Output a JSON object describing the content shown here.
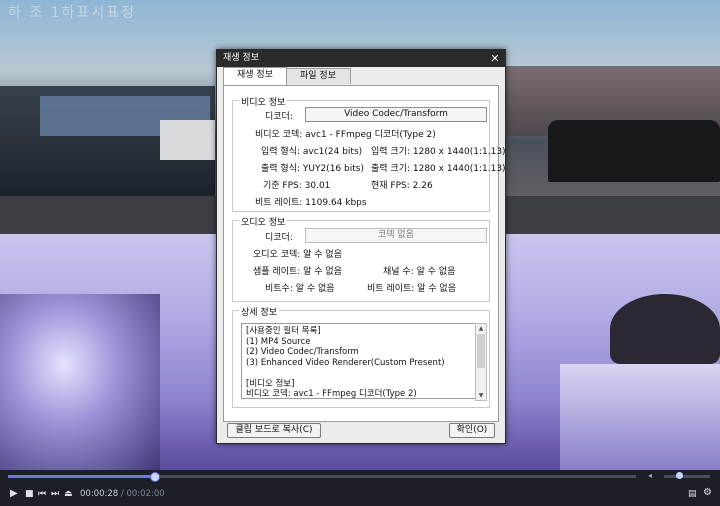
{
  "video": {
    "overlay_text": "하 조 1하표시표정"
  },
  "dialog": {
    "title": "재생 정보",
    "close_glyph": "✕",
    "tabs": [
      {
        "label": "재생 정보",
        "active": true
      },
      {
        "label": "파일 정보",
        "active": false
      }
    ],
    "video_info": {
      "legend": "비디오 정보",
      "decoder_label": "디코더:",
      "decoder_value": "Video Codec/Transform",
      "codec": "비디오 코덱: avc1 - FFmpeg 디코더(Type 2)",
      "input_format": "입력 형식: avc1(24 bits)",
      "input_size": "입력 크기:  1280 x 1440(1:1.13)",
      "output_format": "출력 형식: YUY2(16 bits)",
      "output_size": "출력 크기:  1280 x 1440(1:1.13)",
      "base_fps": "기준 FPS: 30.01",
      "current_fps": "현재 FPS:  2.26",
      "bitrate": "비트 레이트: 1109.64 kbps"
    },
    "audio_info": {
      "legend": "오디오 정보",
      "decoder_label": "디코더:",
      "decoder_value": "코덱 없음",
      "codec": "오디오 코덱: 알 수 없음",
      "sample_rate": "샘플 레이트: 알 수 없음",
      "channels": "채널 수: 알 수 없음",
      "bits": "비트수: 알 수 없음",
      "bitrate": "비트 레이트: 알 수 없음"
    },
    "detail_info": {
      "legend": "상세 정보",
      "lines": [
        "[사용중인 필터 목록]",
        "(1) MP4 Source",
        "(2) Video Codec/Transform",
        "(3) Enhanced Video Renderer(Custom Present)",
        "",
        "[비디오 정보]",
        "비디오 코덱: avc1 - FFmpeg 디코더(Type 2)"
      ]
    },
    "copy_button": "클립 보드로 복사(C)",
    "ok_button": "확인(O)"
  },
  "player": {
    "current_time": "00:00:28",
    "separator": " / ",
    "total_time": "00:02:00",
    "progress_fraction": 0.233,
    "volume_fraction": 0.33
  },
  "icons": {
    "play": "play-icon",
    "stop": "stop-icon",
    "prev": "previous-icon",
    "next": "next-icon",
    "eject": "eject-icon",
    "playlist": "playlist-icon",
    "settings": "gear-icon",
    "volume": "speaker-icon"
  }
}
